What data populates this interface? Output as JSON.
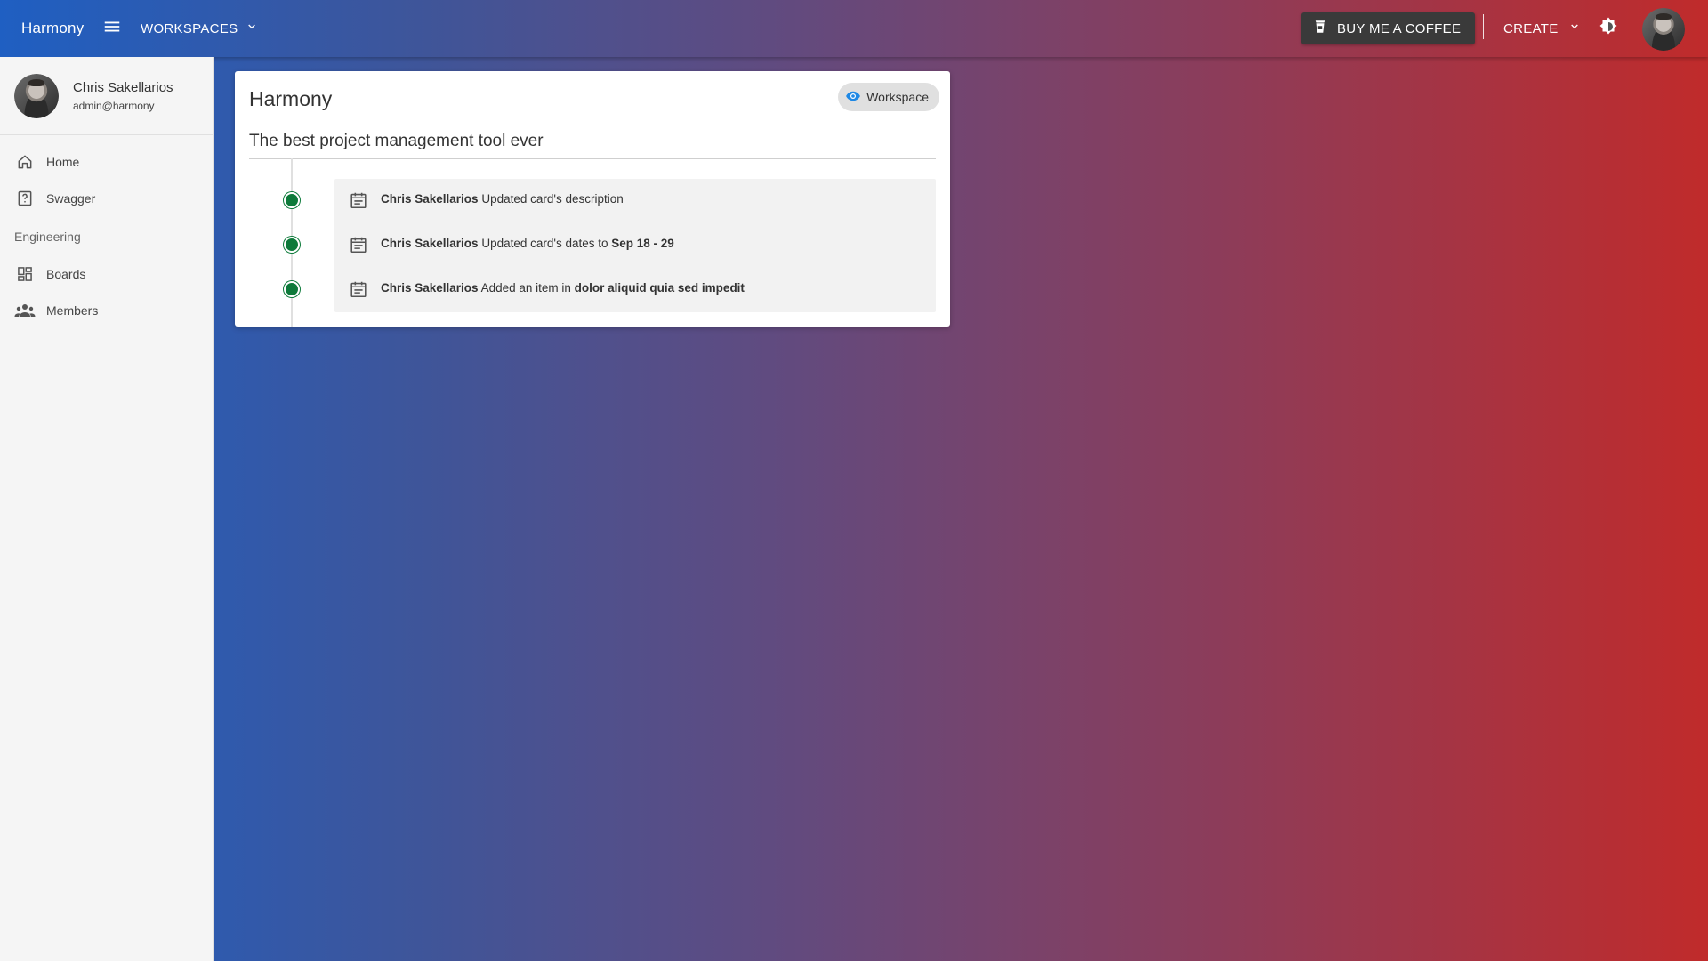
{
  "app": {
    "title": "Harmony",
    "workspaces_label": "WORKSPACES",
    "coffee_label": "BUY ME A COFFEE",
    "create_label": "CREATE"
  },
  "user": {
    "name": "Chris Sakellarios",
    "email": "admin@harmony"
  },
  "sidebar": {
    "items": [
      {
        "label": "Home",
        "icon": "home-icon"
      },
      {
        "label": "Swagger",
        "icon": "help-box-icon"
      }
    ],
    "section_label": "Engineering",
    "section_items": [
      {
        "label": "Boards",
        "icon": "dashboard-icon"
      },
      {
        "label": "Members",
        "icon": "people-icon"
      }
    ]
  },
  "workspace": {
    "title": "Harmony",
    "visibility_chip": "Workspace",
    "description": "The best project management tool ever",
    "activities": [
      {
        "user": "Chris Sakellarios",
        "text": "Updated card's description",
        "highlight": ""
      },
      {
        "user": "Chris Sakellarios",
        "text": "Updated card's dates to",
        "highlight": "Sep 18 - 29"
      },
      {
        "user": "Chris Sakellarios",
        "text": "Added an item in",
        "highlight": "dolor aliquid quia sed impedit"
      }
    ]
  },
  "colors": {
    "gradient_start": "#1f5fc2",
    "gradient_end": "#c02b2b",
    "timeline_dot": "#0d7a3a",
    "chip_icon": "#1e88e5"
  }
}
